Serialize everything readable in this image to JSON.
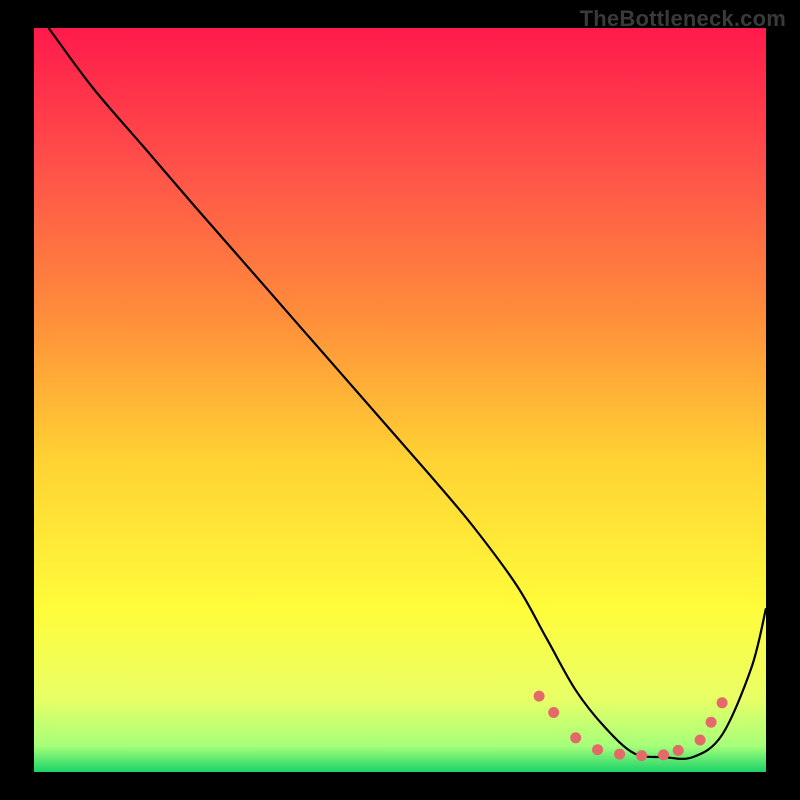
{
  "watermark": {
    "text": "TheBottleneck.com"
  },
  "chart_data": {
    "type": "line",
    "title": "",
    "xlabel": "",
    "ylabel": "",
    "xlim": [
      0,
      100
    ],
    "ylim": [
      0,
      100
    ],
    "grid": false,
    "legend": false,
    "background_gradient": {
      "type": "vertical",
      "stops": [
        {
          "pos": 0.0,
          "color": "#ff1a4b"
        },
        {
          "pos": 0.18,
          "color": "#ff4f4a"
        },
        {
          "pos": 0.38,
          "color": "#ff8b3b"
        },
        {
          "pos": 0.58,
          "color": "#ffd233"
        },
        {
          "pos": 0.78,
          "color": "#fffc3a"
        },
        {
          "pos": 0.9,
          "color": "#eaff66"
        },
        {
          "pos": 0.965,
          "color": "#a6ff7a"
        },
        {
          "pos": 1.0,
          "color": "#1bd36a"
        }
      ]
    },
    "series": [
      {
        "name": "bottleneck-curve",
        "color": "#000000",
        "width": 2.2,
        "x": [
          2,
          8,
          15,
          22,
          30,
          38,
          46,
          54,
          60,
          66,
          70,
          74,
          78,
          82,
          86,
          90,
          94,
          98,
          100
        ],
        "y": [
          100,
          92,
          84,
          76,
          67,
          58,
          49,
          40,
          33,
          25,
          18,
          11,
          6,
          2.5,
          2,
          2,
          5,
          14,
          22
        ]
      }
    ],
    "markers": {
      "name": "highlight-dots",
      "color": "#e46a6a",
      "radius": 5.5,
      "points": [
        {
          "x": 69,
          "y": 10.2
        },
        {
          "x": 71,
          "y": 8.0
        },
        {
          "x": 74,
          "y": 4.6
        },
        {
          "x": 77,
          "y": 3.0
        },
        {
          "x": 80,
          "y": 2.4
        },
        {
          "x": 83,
          "y": 2.2
        },
        {
          "x": 86,
          "y": 2.3
        },
        {
          "x": 88,
          "y": 2.9
        },
        {
          "x": 91,
          "y": 4.3
        },
        {
          "x": 92.5,
          "y": 6.7
        },
        {
          "x": 94,
          "y": 9.3
        }
      ]
    }
  }
}
